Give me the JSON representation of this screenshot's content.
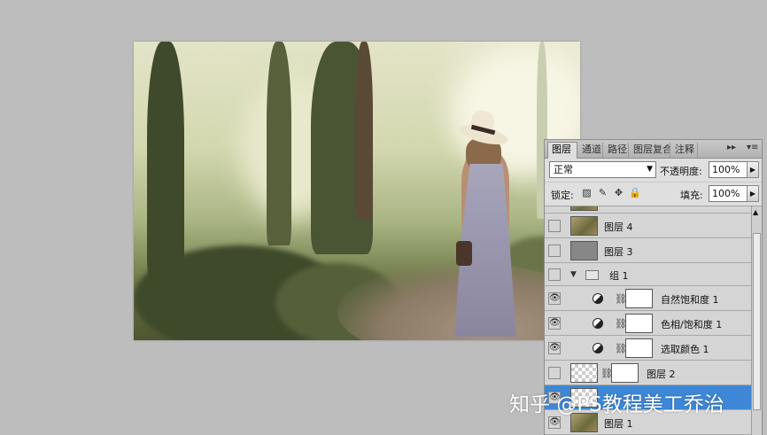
{
  "panel": {
    "tabs": [
      "图层",
      "通道",
      "路径",
      "图层复合",
      "注释"
    ],
    "blend_mode": "正常",
    "opacity_label": "不透明度:",
    "opacity_value": "100%",
    "lock_label": "锁定:",
    "fill_label": "填充:",
    "fill_value": "100%",
    "layers": [
      {
        "name": "图层 4",
        "visible": false,
        "thumb": "photo"
      },
      {
        "name": "图层 3",
        "visible": false,
        "thumb": "gray"
      },
      {
        "name": "组 1",
        "visible": false,
        "type": "group",
        "expanded": true
      },
      {
        "name": "自然饱和度 1",
        "visible": true,
        "type": "adjustment"
      },
      {
        "name": "色相/饱和度 1",
        "visible": true,
        "type": "adjustment"
      },
      {
        "name": "选取颜色 1",
        "visible": true,
        "type": "adjustment"
      },
      {
        "name": "图层 2",
        "visible": false,
        "thumb": "checker",
        "mask": true
      },
      {
        "name": "",
        "visible": true,
        "thumb": "checker",
        "selected": true
      },
      {
        "name": "图层 1",
        "visible": true,
        "thumb": "photo"
      }
    ]
  },
  "watermark": "知乎 @PS教程美工乔治",
  "colors": {
    "selection": "#3e87d6",
    "workspace": "#bdbdbd"
  }
}
